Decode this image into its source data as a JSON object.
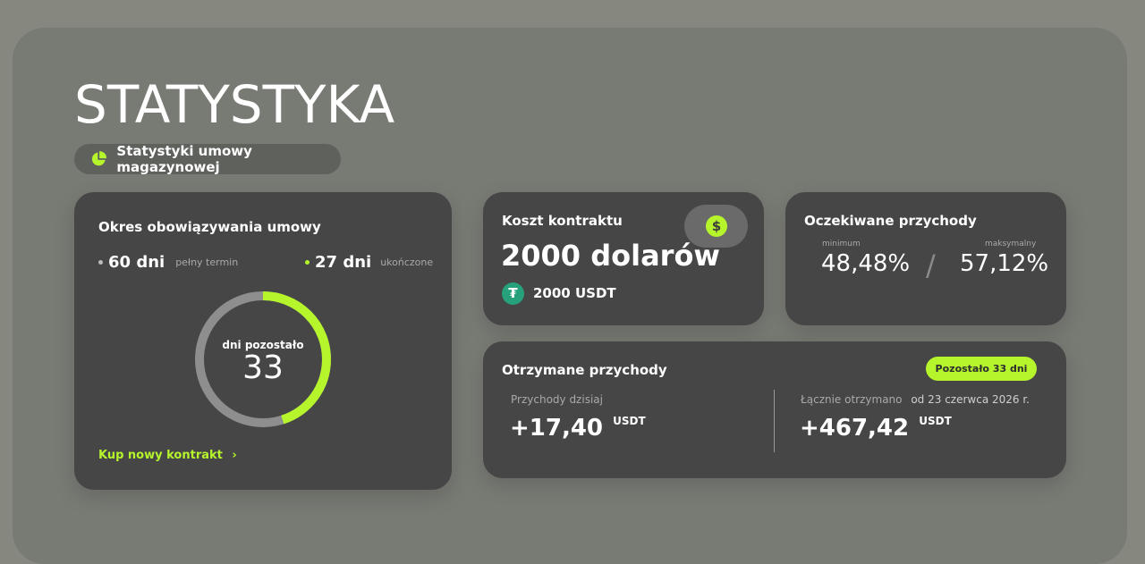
{
  "page": {
    "title": "STATYSTYKA",
    "chip_label": "Statystyki umowy magazynowej"
  },
  "colors": {
    "accent": "#b6f52c",
    "card": "#464646",
    "ring_track": "#8e8e8e",
    "usdt": "#26a17b"
  },
  "term_card": {
    "title": "Okres obowiązywania umowy",
    "total_value": "60 dni",
    "total_label": "pełny termin",
    "done_value": "27 dni",
    "done_label": "ukończone",
    "remaining_label": "dni pozostało",
    "remaining_value": "33",
    "progress_fraction": 0.45,
    "cta_label": "Kup nowy kontrakt",
    "cta_chevron": "›"
  },
  "cost_card": {
    "title": "Koszt kontraktu",
    "amount": "2000 dolarów",
    "usdt_amount": "2000 USDT",
    "dollar_icon_glyph": "$",
    "usdt_icon_glyph": "₮"
  },
  "expected_card": {
    "title": "Oczekiwane przychody",
    "min_label": "minimum",
    "min_value": "48,48%",
    "max_label": "maksymalny",
    "max_value": "57,12%",
    "separator": "/"
  },
  "received_card": {
    "title": "Otrzymane przychody",
    "badge": "Pozostało 33 dni",
    "today_label": "Przychody dzisiaj",
    "today_value": "+17,40",
    "today_unit": "USDT",
    "total_label": "Łącznie otrzymano",
    "total_since": "od 23 czerwca 2026 r.",
    "total_value": "+467,42",
    "total_unit": "USDT"
  }
}
